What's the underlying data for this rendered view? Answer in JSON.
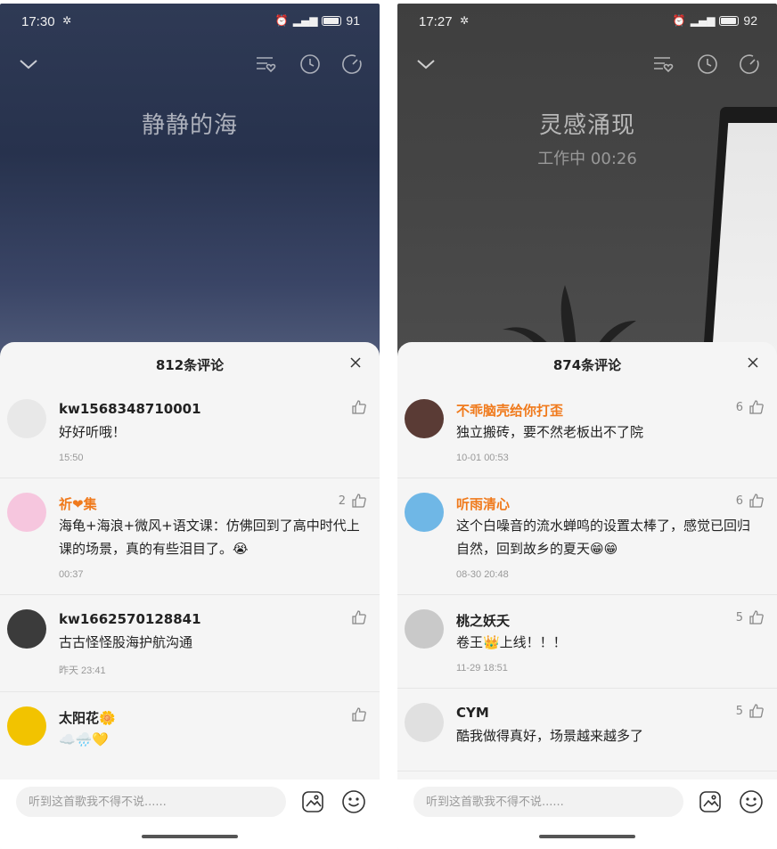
{
  "left": {
    "status": {
      "time": "17:30",
      "battery": "91"
    },
    "scene_title": "静静的海",
    "scene_subtitle": "",
    "sheet_title": "812条评论",
    "comments": [
      {
        "user": "kw1568348710001",
        "highlight": false,
        "text": "好好听哦！",
        "time": "15:50",
        "likes": "",
        "avatar_color": "#e8e8e8"
      },
      {
        "user": "祈❤集",
        "highlight": true,
        "text": "海龟+海浪+微风+语文课：仿佛回到了高中时代上课的场景，真的有些泪目了。😭",
        "time": "00:37",
        "likes": "2",
        "avatar_color": "#f6c6de"
      },
      {
        "user": "kw1662570128841",
        "highlight": false,
        "text": "古古怪怪股海护航沟通",
        "time": "昨天 23:41",
        "likes": "",
        "avatar_color": "#3b3b3b"
      },
      {
        "user": "太阳花🌼",
        "highlight": false,
        "text": "☁️🌧️💛",
        "time": "",
        "likes": "",
        "avatar_color": "#f2c300"
      }
    ],
    "input_placeholder": "听到这首歌我不得不说......"
  },
  "right": {
    "status": {
      "time": "17:27",
      "battery": "92"
    },
    "scene_title": "灵感涌现",
    "scene_subtitle": "工作中 00:26",
    "sheet_title": "874条评论",
    "comments": [
      {
        "user": "不乖脑壳给你打歪",
        "highlight": true,
        "text": "独立搬砖，要不然老板出不了院",
        "time": "10-01 00:53",
        "likes": "6",
        "avatar_color": "#5a3b35"
      },
      {
        "user": "听雨清心",
        "highlight": true,
        "text": "这个白噪音的流水蝉鸣的设置太棒了，感觉已回归自然，回到故乡的夏天😁😁",
        "time": "08-30 20:48",
        "likes": "6",
        "avatar_color": "#6fb7e6"
      },
      {
        "user": "桃之妖夭",
        "highlight": false,
        "text": "卷王👑上线！！！",
        "time": "11-29 18:51",
        "likes": "5",
        "avatar_color": "#c9c9c9"
      },
      {
        "user": "CYM",
        "highlight": false,
        "text": "酷我做得真好，场景越来越多了",
        "time": "",
        "likes": "5",
        "avatar_color": "#e0e0e0"
      }
    ],
    "input_placeholder": "听到这首歌我不得不说......"
  },
  "icons": {
    "back": "chevron-down-icon",
    "playlist": "playlist-heart-icon",
    "clock": "clock-icon",
    "timer": "timer-icon",
    "like": "thumbs-up-icon",
    "close": "close-icon",
    "image": "image-icon",
    "emoji": "smile-icon"
  }
}
